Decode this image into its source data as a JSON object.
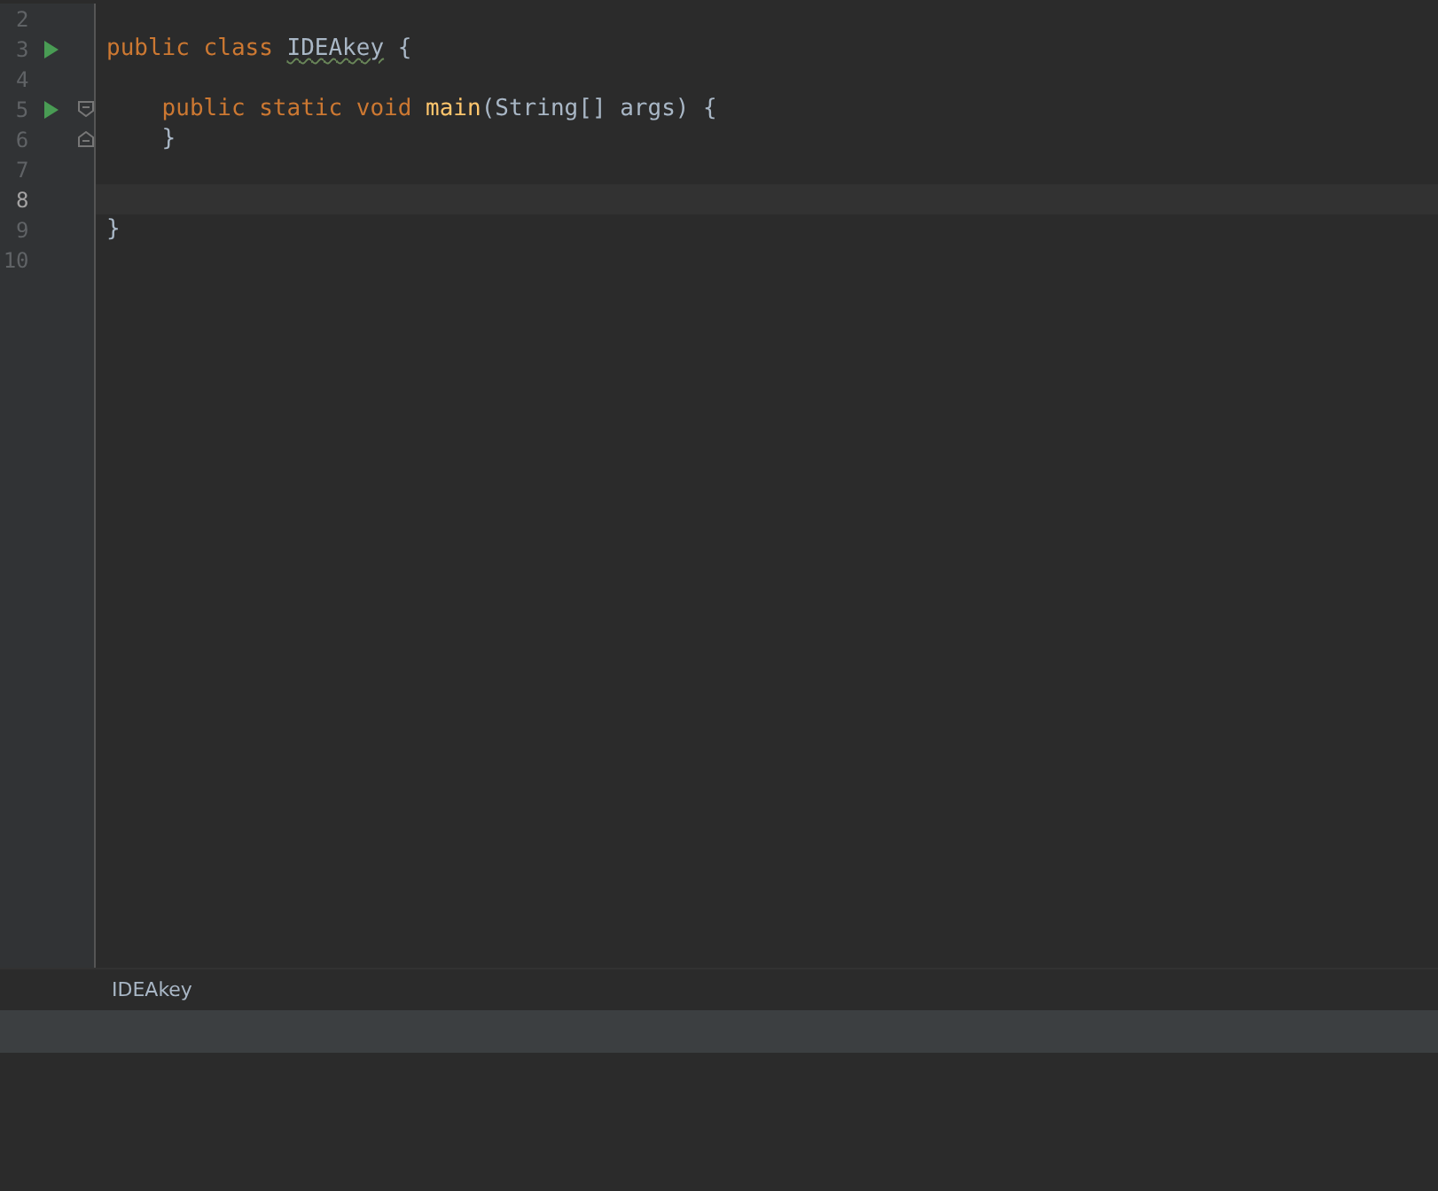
{
  "editor": {
    "lines": [
      {
        "number": "2",
        "kind": "plain",
        "run": false,
        "current": false
      },
      {
        "number": "3",
        "kind": "plain",
        "run": true,
        "current": false,
        "tokens": [
          {
            "kind": "keyword",
            "text": "public class "
          },
          {
            "kind": "class",
            "text": "IDEAkey",
            "warning": true
          },
          {
            "kind": "plain",
            "text": " {"
          }
        ]
      },
      {
        "number": "4",
        "kind": "plain",
        "run": false,
        "current": false
      },
      {
        "number": "5",
        "kind": "fold-start",
        "run": true,
        "current": false,
        "tokens": [
          {
            "kind": "keyword",
            "text": "    public static void "
          },
          {
            "kind": "method",
            "text": "main"
          },
          {
            "kind": "plain",
            "text": "(String[] args) {"
          }
        ]
      },
      {
        "number": "6",
        "kind": "fold-end",
        "run": false,
        "current": false,
        "tokens": [
          {
            "kind": "plain",
            "text": "    }"
          }
        ]
      },
      {
        "number": "7",
        "kind": "plain",
        "run": false,
        "current": false
      },
      {
        "number": "8",
        "kind": "plain",
        "run": false,
        "current": true
      },
      {
        "number": "9",
        "kind": "plain",
        "run": false,
        "current": false,
        "tokens": [
          {
            "kind": "plain",
            "text": "}"
          }
        ]
      },
      {
        "number": "10",
        "kind": "plain",
        "run": false,
        "current": false
      }
    ]
  },
  "breadcrumb": "IDEAkey"
}
